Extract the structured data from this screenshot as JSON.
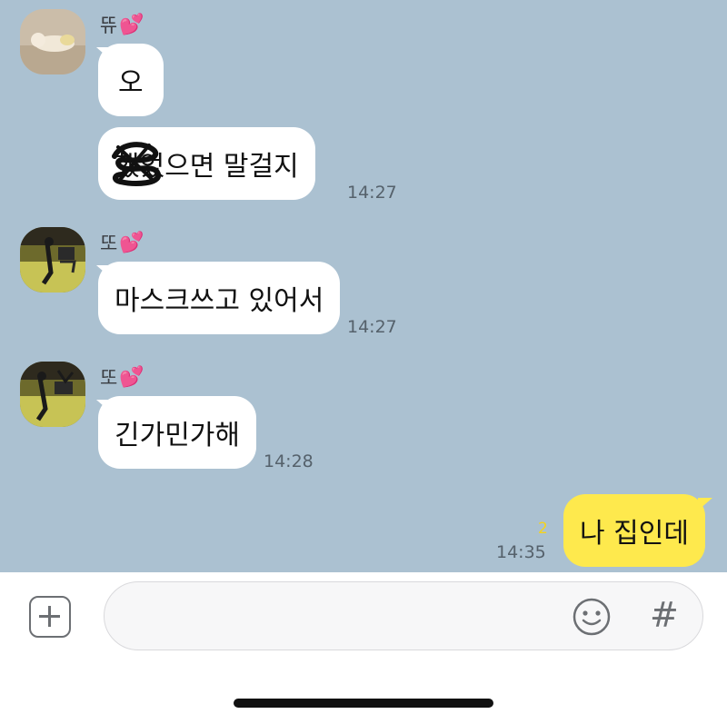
{
  "messages": [
    {
      "sender": "뜌",
      "heart": "💕",
      "text": "오",
      "time": ""
    },
    {
      "sender": "",
      "heart": "",
      "text": "했었으면 말걸지",
      "time": "14:27"
    },
    {
      "sender": "또",
      "heart": "💕",
      "text": "마스크쓰고 있어서",
      "time": "14:27"
    },
    {
      "sender": "또",
      "heart": "💕",
      "text": "긴가민가해",
      "time": "14:28"
    },
    {
      "sender": "",
      "heart": "",
      "text": "나 집인데",
      "time": "14:35",
      "unread": "2",
      "outgoing": true
    }
  ],
  "input": {
    "placeholder": "",
    "hash_label": "#"
  },
  "colors": {
    "chat_background": "#abc1d1",
    "incoming_bubble": "#ffffff",
    "outgoing_bubble": "#fee94d",
    "unread_count": "#f5d31d"
  },
  "icons": [
    "plus-icon",
    "emoji-icon",
    "hash-icon"
  ]
}
